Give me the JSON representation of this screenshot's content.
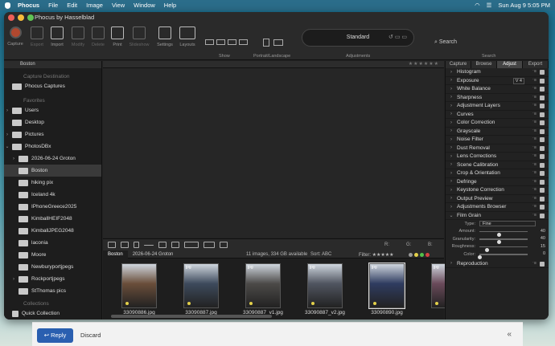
{
  "menubar": {
    "app": "Phocus",
    "items": [
      "File",
      "Edit",
      "Image",
      "View",
      "Window",
      "Help"
    ],
    "clock": "Sun Aug 9  5:05 PM"
  },
  "window": {
    "title": "Phocus by Hasselblad"
  },
  "toolbar": {
    "buttons": [
      {
        "label": "Capture",
        "icon": "capture-icon"
      },
      {
        "label": "Export",
        "icon": "export-icon"
      },
      {
        "label": "Import",
        "icon": "import-icon"
      },
      {
        "label": "Modify",
        "icon": "modify-icon"
      },
      {
        "label": "Delete",
        "icon": "delete-icon"
      },
      {
        "label": "Print",
        "icon": "print-icon"
      },
      {
        "label": "Slideshow",
        "icon": "slideshow-icon"
      },
      {
        "label": "Settings",
        "icon": "settings-icon"
      },
      {
        "label": "Layouts",
        "icon": "layouts-icon"
      }
    ],
    "show_label": "Show",
    "portrait_label": "Portrait/Landscape",
    "preset": "Standard",
    "adjustments_label": "Adjustments",
    "search": "Search",
    "search_label": "Search"
  },
  "sidebar": {
    "path": "Boston",
    "capture_destination": "Capture Destination",
    "phocus_captures": "Phocus Captures",
    "favorites": "Favorites",
    "folders": [
      {
        "label": "Users",
        "arrow": "›",
        "indent": 0,
        "sel": false
      },
      {
        "label": "Desktop",
        "arrow": "",
        "indent": 0,
        "sel": false
      },
      {
        "label": "Pictures",
        "arrow": "›",
        "indent": 0,
        "sel": false
      },
      {
        "label": "PhotosDBx",
        "arrow": "⌄",
        "indent": 0,
        "sel": false
      },
      {
        "label": "2026-06-24 Groton",
        "arrow": "›",
        "indent": 1,
        "sel": false
      },
      {
        "label": "Boston",
        "arrow": "",
        "indent": 1,
        "sel": true
      },
      {
        "label": "hiking pix",
        "arrow": "",
        "indent": 1,
        "sel": false
      },
      {
        "label": "Iceland 4k",
        "arrow": "",
        "indent": 1,
        "sel": false
      },
      {
        "label": "IPhoneGreece2025",
        "arrow": "",
        "indent": 1,
        "sel": false
      },
      {
        "label": "KimballHEIF2048",
        "arrow": "",
        "indent": 1,
        "sel": false
      },
      {
        "label": "KimballJPEG2048",
        "arrow": "",
        "indent": 1,
        "sel": false
      },
      {
        "label": "laconia",
        "arrow": "",
        "indent": 1,
        "sel": false
      },
      {
        "label": "Moore",
        "arrow": "",
        "indent": 1,
        "sel": false
      },
      {
        "label": "Newburyportjpegs",
        "arrow": "",
        "indent": 1,
        "sel": false
      },
      {
        "label": "Rockportjpegs",
        "arrow": "›",
        "indent": 1,
        "sel": false
      },
      {
        "label": "StThomas pics",
        "arrow": "",
        "indent": 1,
        "sel": false
      }
    ],
    "collections": "Collections",
    "quick_collection": "Quick Collection"
  },
  "viewer_tools": {
    "r": "R:",
    "g": "G:",
    "b": "B:"
  },
  "browser": {
    "tab_active": "Boston",
    "tab_other": "2026-06-24 Groton",
    "count": "11 images, 334 GB available",
    "sort": "Sort:",
    "sort_value": "ABC",
    "filter": "Filter:",
    "thumbs": [
      {
        "name": "33090886.jpg",
        "tag": "",
        "sel": false,
        "bg": "#6a4e3a"
      },
      {
        "name": "33090887.jpg",
        "tag": "jpg",
        "sel": false,
        "bg": "#3d4a5c"
      },
      {
        "name": "33090887_v1.jpg",
        "tag": "jpg",
        "sel": false,
        "bg": "#4c4a48"
      },
      {
        "name": "33090887_v2.jpg",
        "tag": "jpg",
        "sel": false,
        "bg": "#505560"
      },
      {
        "name": "33090890.jpg",
        "tag": "jpg",
        "sel": true,
        "bg": "#2f3c60"
      },
      {
        "name": "",
        "tag": "jpg",
        "sel": false,
        "bg": "#6a4a5a"
      }
    ]
  },
  "panel": {
    "tabs": [
      "Capture",
      "Browse",
      "Adjust",
      "Export"
    ],
    "active_tab": "Adjust",
    "tools": [
      {
        "label": "Histogram",
        "val": ""
      },
      {
        "label": "Exposure",
        "val": "V 4"
      },
      {
        "label": "White Balance",
        "val": ""
      },
      {
        "label": "Sharpness",
        "val": ""
      },
      {
        "label": "Adjustment Layers",
        "val": ""
      },
      {
        "label": "Curves",
        "val": ""
      },
      {
        "label": "Color Correction",
        "val": ""
      },
      {
        "label": "Grayscale",
        "val": ""
      },
      {
        "label": "Noise Filter",
        "val": ""
      },
      {
        "label": "Dust Removal",
        "val": ""
      },
      {
        "label": "Lens Corrections",
        "val": ""
      },
      {
        "label": "Scene Calibration",
        "val": ""
      },
      {
        "label": "Crop & Orientation",
        "val": ""
      },
      {
        "label": "Defringe",
        "val": ""
      },
      {
        "label": "Keystone Correction",
        "val": ""
      },
      {
        "label": "Output Preview",
        "val": ""
      },
      {
        "label": "Adjustments Browser",
        "val": ""
      },
      {
        "label": "Film Grain",
        "val": ""
      }
    ],
    "grain": {
      "type_label": "Type:",
      "type_value": "Fine",
      "amount_label": "Amount:",
      "amount": "40",
      "amount_f": 0.4,
      "granularity_label": "Granularity:",
      "granularity": "40",
      "granularity_f": 0.4,
      "roughness_label": "Roughness:",
      "roughness": "15",
      "roughness_f": 0.15,
      "color_label": "Color:",
      "color": "0",
      "color_f": 0
    },
    "reproduction": "Reproduction"
  },
  "mail": {
    "reply": "Reply",
    "discard": "Discard"
  }
}
